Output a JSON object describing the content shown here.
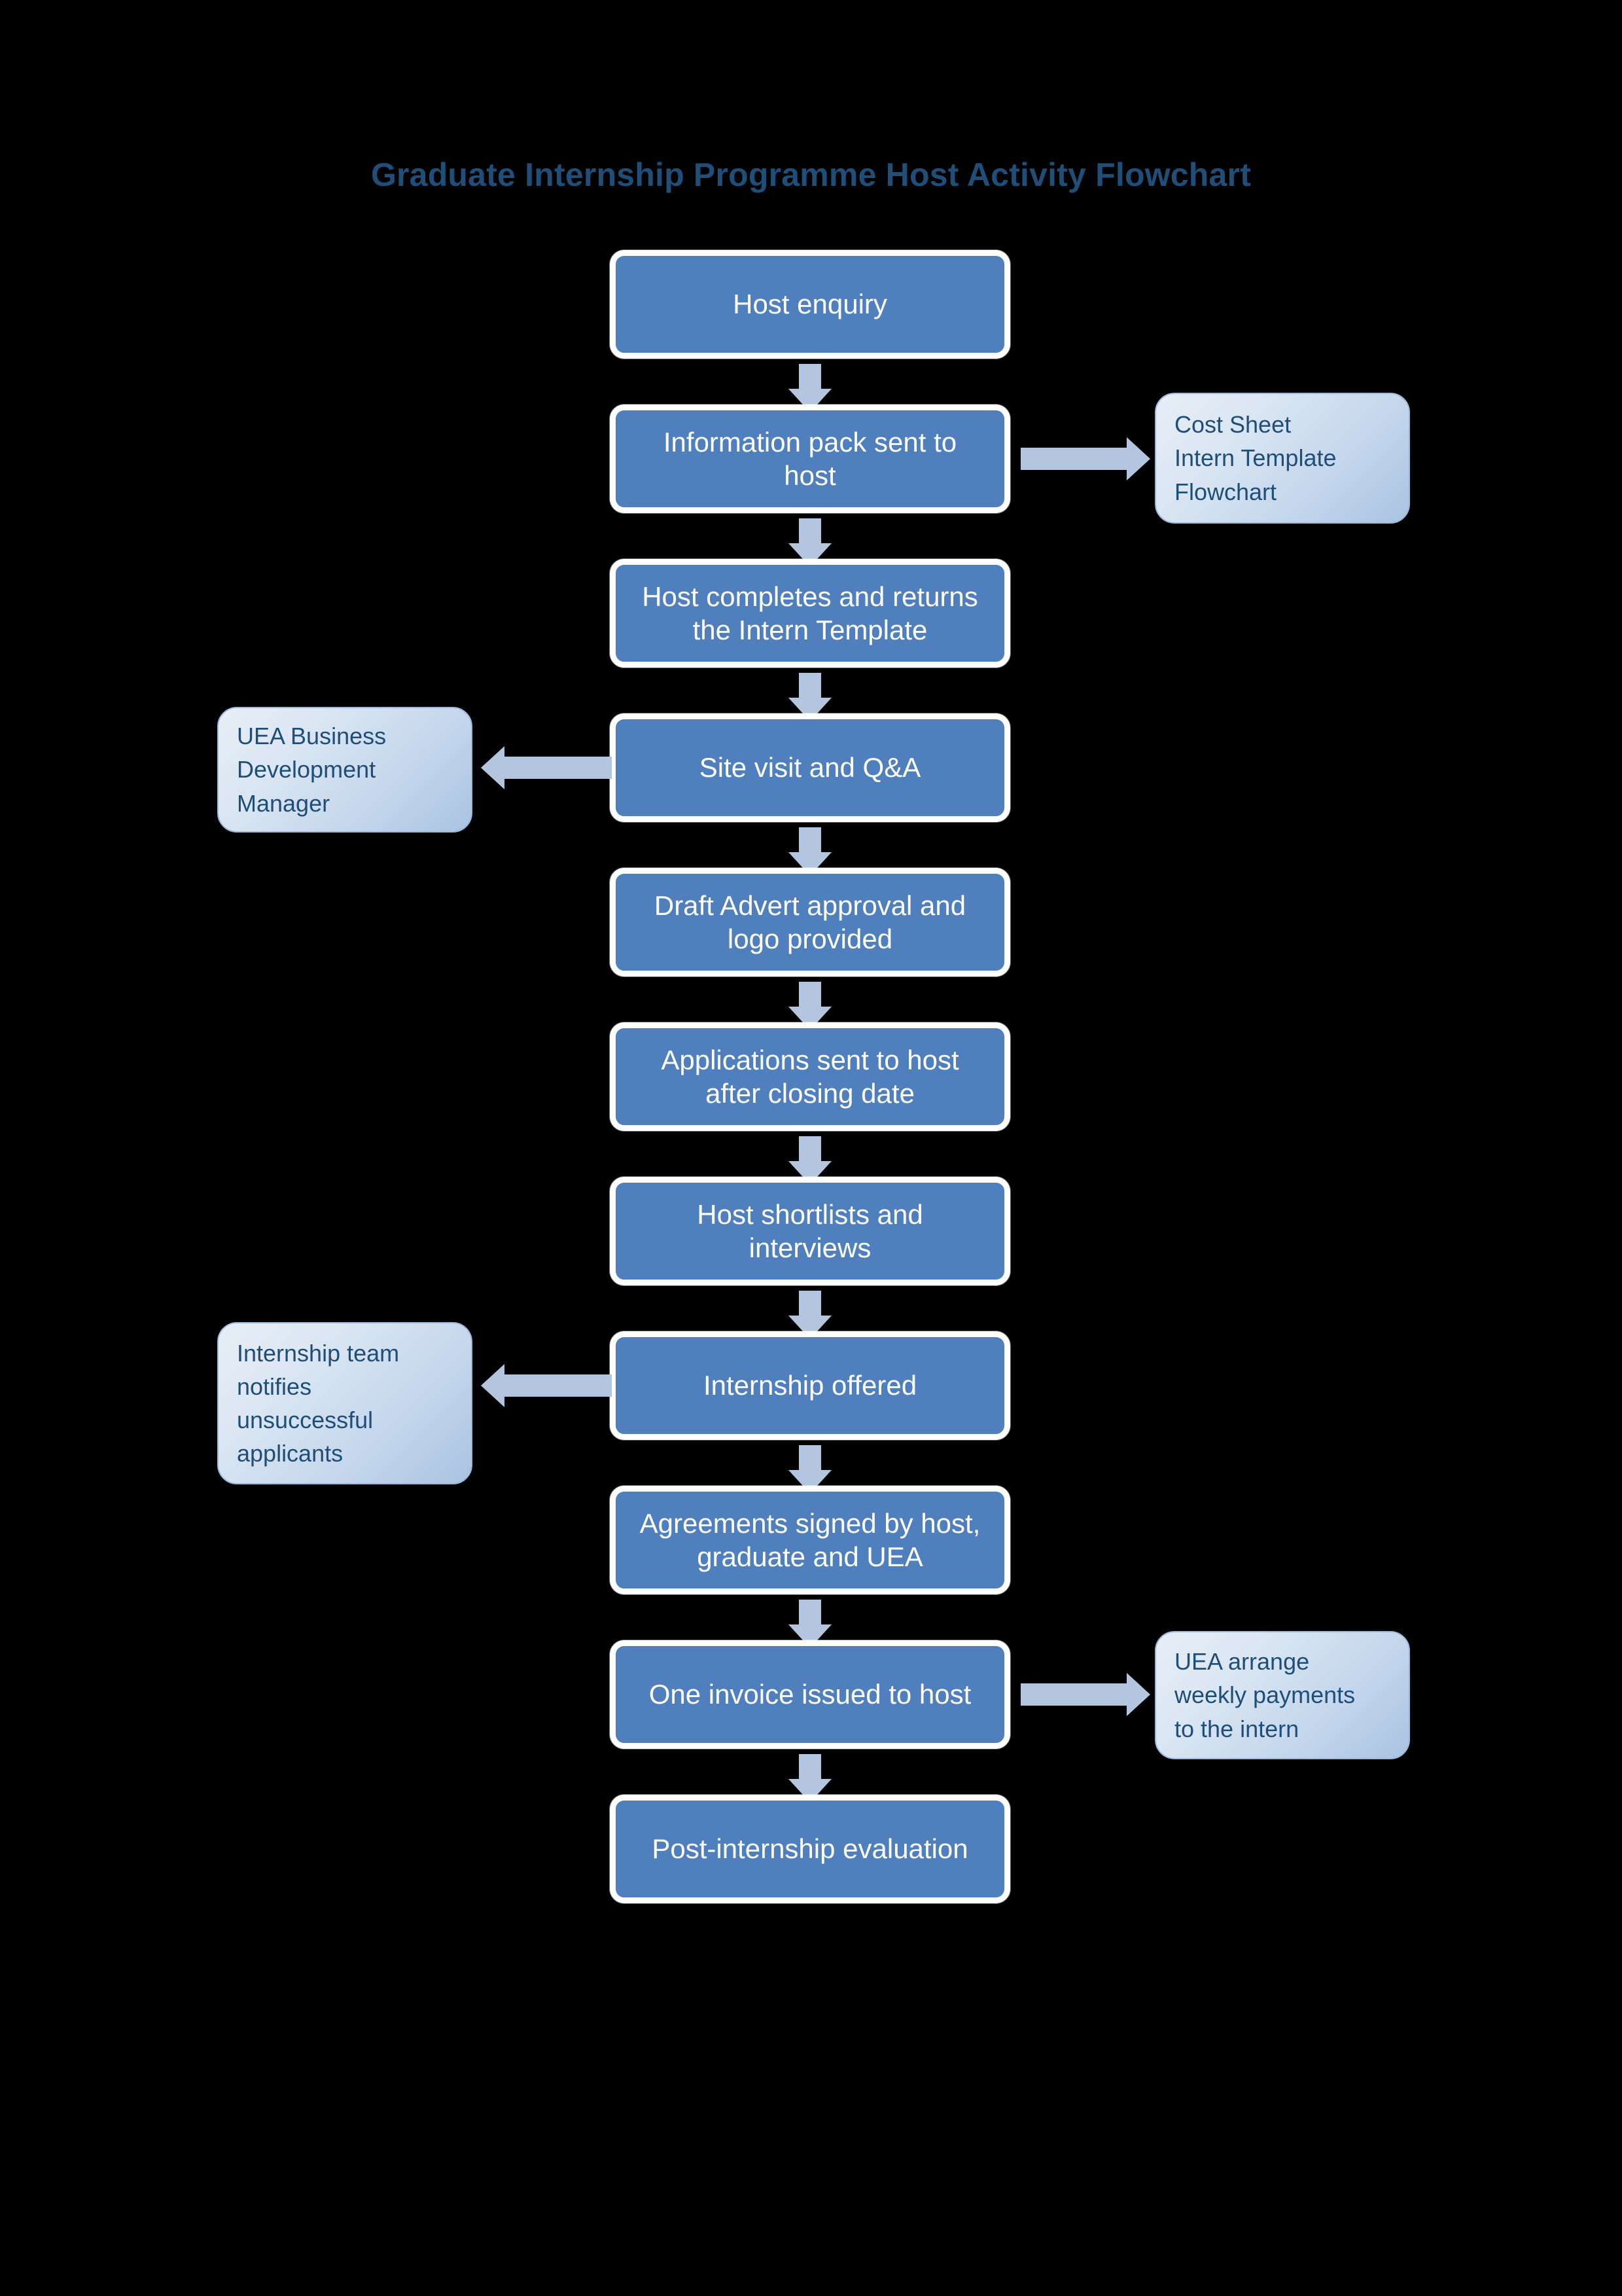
{
  "title": "Graduate Internship Programme Host Activity Flowchart",
  "colors": {
    "background": "#000000",
    "title_text": "#1F4E79",
    "node_fill": "#4F80BD",
    "node_border": "#FFFFFF",
    "node_text": "#FFFFFF",
    "note_fill_light": "#E7EEF7",
    "note_fill_dark": "#A9C3E1",
    "note_text": "#1F4E79",
    "arrow_fill": "#B4C6DF"
  },
  "chart_data": {
    "type": "diagram",
    "diagram_kind": "flowchart",
    "title": "Graduate Internship Programme Host Activity Flowchart",
    "orientation": "top-to-bottom",
    "nodes": [
      {
        "id": "n1",
        "label": "Host enquiry",
        "kind": "process"
      },
      {
        "id": "n2",
        "label": "Information pack sent to host",
        "kind": "process"
      },
      {
        "id": "n3",
        "label": "Host completes and returns the Intern Template",
        "kind": "process"
      },
      {
        "id": "n4",
        "label": "Site visit and Q&A",
        "kind": "process"
      },
      {
        "id": "n5",
        "label": "Draft Advert approval and logo provided",
        "kind": "process"
      },
      {
        "id": "n6",
        "label": "Applications sent to host after closing date",
        "kind": "process"
      },
      {
        "id": "n7",
        "label": "Host shortlists and interviews",
        "kind": "process"
      },
      {
        "id": "n8",
        "label": "Internship offered",
        "kind": "process"
      },
      {
        "id": "n9",
        "label": "Agreements signed by host, graduate and UEA",
        "kind": "process"
      },
      {
        "id": "n10",
        "label": "One invoice issued to host",
        "kind": "process"
      },
      {
        "id": "n11",
        "label": "Post-internship evaluation",
        "kind": "process"
      },
      {
        "id": "s1",
        "label": "Cost Sheet\nIntern Template\nFlowchart",
        "kind": "note",
        "side": "right"
      },
      {
        "id": "s2",
        "label": "UEA Business Development Manager",
        "kind": "note",
        "side": "left"
      },
      {
        "id": "s3",
        "label": "Internship team notifies unsuccessful applicants",
        "kind": "note",
        "side": "left"
      },
      {
        "id": "s4",
        "label": "UEA arrange weekly payments to the intern",
        "kind": "note",
        "side": "right"
      }
    ],
    "edges": [
      {
        "from": "n1",
        "to": "n2",
        "direction": "down"
      },
      {
        "from": "n2",
        "to": "s1",
        "direction": "right"
      },
      {
        "from": "n2",
        "to": "n3",
        "direction": "down"
      },
      {
        "from": "n3",
        "to": "n4",
        "direction": "down"
      },
      {
        "from": "n4",
        "to": "s2",
        "direction": "left"
      },
      {
        "from": "n4",
        "to": "n5",
        "direction": "down"
      },
      {
        "from": "n5",
        "to": "n6",
        "direction": "down"
      },
      {
        "from": "n6",
        "to": "n7",
        "direction": "down"
      },
      {
        "from": "n7",
        "to": "n8",
        "direction": "down"
      },
      {
        "from": "n8",
        "to": "s3",
        "direction": "left"
      },
      {
        "from": "n8",
        "to": "n9",
        "direction": "down"
      },
      {
        "from": "n9",
        "to": "n10",
        "direction": "down"
      },
      {
        "from": "n10",
        "to": "s4",
        "direction": "right"
      },
      {
        "from": "n10",
        "to": "n11",
        "direction": "down"
      }
    ]
  },
  "nodes": {
    "n1": {
      "line1": "Host enquiry"
    },
    "n2": {
      "line1": "Information pack sent to",
      "line2": "host"
    },
    "n3": {
      "line1": "Host completes and returns",
      "line2": "the Intern Template"
    },
    "n4": {
      "line1": "Site visit and Q&A"
    },
    "n5": {
      "line1": "Draft Advert approval and",
      "line2": "logo provided"
    },
    "n6": {
      "line1": "Applications sent to host",
      "line2": "after closing date"
    },
    "n7": {
      "line1": "Host shortlists and",
      "line2": "interviews"
    },
    "n8": {
      "line1": "Internship offered"
    },
    "n9": {
      "line1": "Agreements signed by host,",
      "line2": "graduate and UEA"
    },
    "n10": {
      "line1": "One invoice issued to host"
    },
    "n11": {
      "line1": "Post-internship evaluation"
    }
  },
  "notes": {
    "s1": {
      "line1": "Cost Sheet",
      "line2": "Intern Template",
      "line3": "Flowchart"
    },
    "s2": {
      "line1": "UEA Business",
      "line2": "Development",
      "line3": "Manager"
    },
    "s3": {
      "line1": "Internship team",
      "line2": "notifies",
      "line3": "unsuccessful",
      "line4": "applicants"
    },
    "s4": {
      "line1": "UEA arrange",
      "line2": "weekly payments",
      "line3": "to the intern"
    }
  }
}
